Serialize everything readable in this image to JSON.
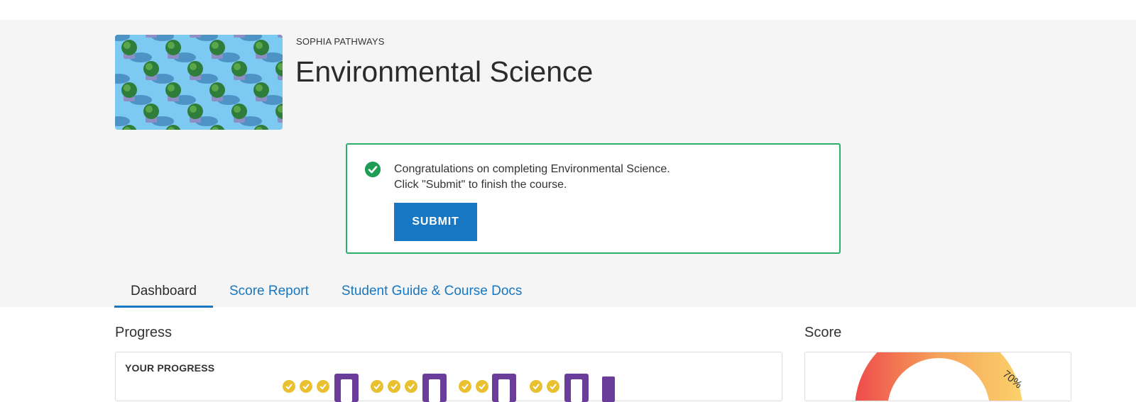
{
  "header": {
    "provider": "SOPHIA PATHWAYS",
    "course_title": "Environmental Science"
  },
  "notice": {
    "line1": "Congratulations on completing Environmental Science.",
    "line2": "Click \"Submit\" to finish the course.",
    "submit_label": "SUBMIT",
    "icon": "check-circle-icon",
    "border_color": "#2bb06b"
  },
  "tabs": [
    {
      "label": "Dashboard",
      "active": true
    },
    {
      "label": "Score Report",
      "active": false
    },
    {
      "label": "Student Guide & Course Docs",
      "active": false
    }
  ],
  "progress": {
    "section_title": "Progress",
    "card_label": "YOUR PROGRESS",
    "completed_color": "#e8c030",
    "milestone_color": "#6a3d9a"
  },
  "score": {
    "section_title": "Score",
    "gauge_label": "70%"
  },
  "colors": {
    "accent": "#1777c2",
    "header_bg": "#f5f5f5"
  }
}
